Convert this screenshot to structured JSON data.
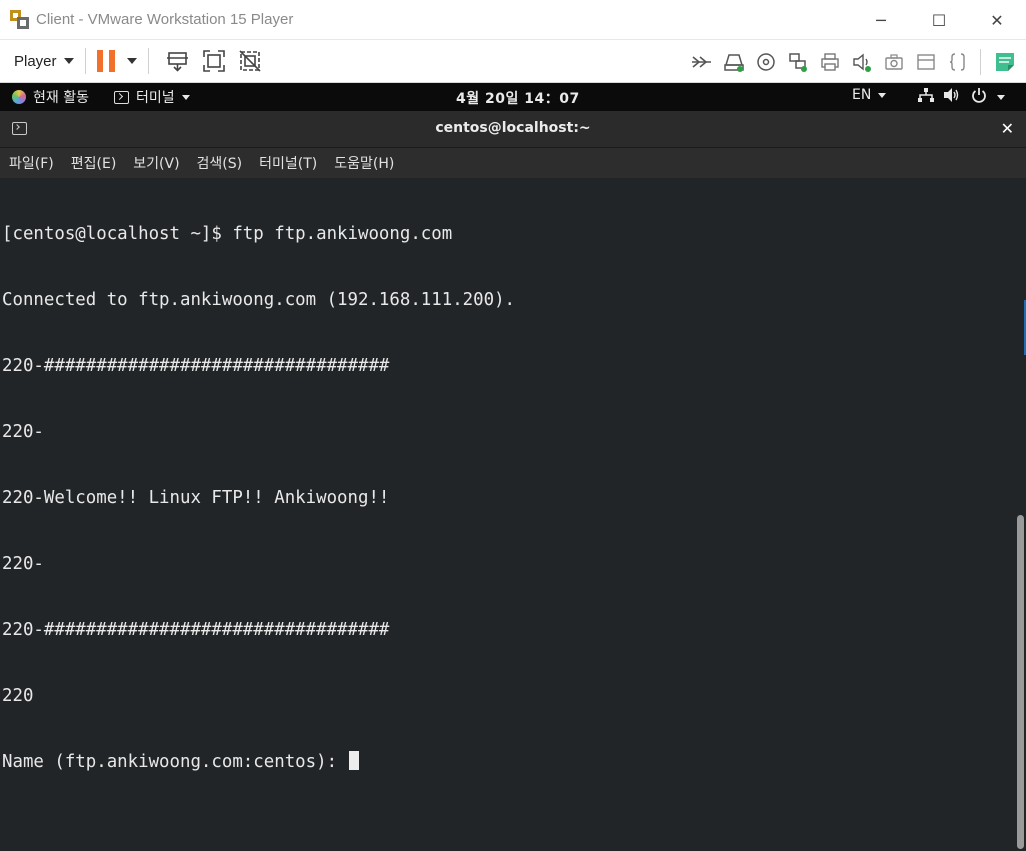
{
  "window": {
    "title": "Client - VMware Workstation 15 Player",
    "minimize": "─",
    "maximize": "☐",
    "close": "✕"
  },
  "toolbar": {
    "player_label": "Player"
  },
  "gnome": {
    "activities_label": "현재 활동",
    "app_label": "터미널",
    "clock": "4월 20일  14：07",
    "language": "EN"
  },
  "terminal": {
    "title": "centos@localhost:~",
    "close_label": "✕",
    "menu": [
      "파일(F)",
      "편집(E)",
      "보기(V)",
      "검색(S)",
      "터미널(T)",
      "도움말(H)"
    ],
    "lines": [
      "[centos@localhost ~]$ ftp ftp.ankiwoong.com",
      "Connected to ftp.ankiwoong.com (192.168.111.200).",
      "220-#################################",
      "220-",
      "220-Welcome!! Linux FTP!! Ankiwoong!!",
      "220-",
      "220-#################################",
      "220"
    ],
    "prompt": "Name (ftp.ankiwoong.com:centos): "
  },
  "colors": {
    "pause_accent": "#f0702c",
    "terminal_bg": "#222527",
    "gnome_bar_bg": "#0b0b0b",
    "vm_status_green": "#2ea043"
  }
}
